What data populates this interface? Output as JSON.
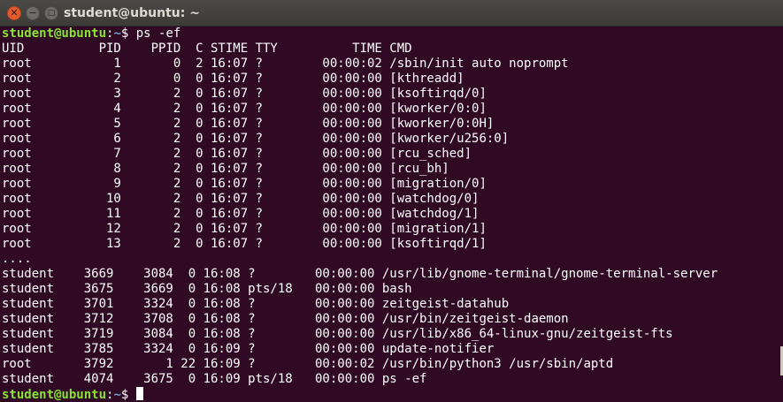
{
  "window": {
    "title": "student@ubuntu: ~",
    "close_glyph": "✕",
    "minimize_glyph": "−",
    "maximize_glyph": "□"
  },
  "terminal": {
    "lines": [
      {
        "kind": "prompt",
        "user": "student@ubuntu",
        "sep": ":",
        "path": "~",
        "symbol": "$ ",
        "cmd": "ps -ef"
      },
      {
        "kind": "text",
        "text": "UID          PID    PPID  C STIME TTY          TIME CMD"
      },
      {
        "kind": "text",
        "text": "root           1       0  2 16:07 ?        00:00:02 /sbin/init auto noprompt"
      },
      {
        "kind": "text",
        "text": "root           2       0  0 16:07 ?        00:00:00 [kthreadd]"
      },
      {
        "kind": "text",
        "text": "root           3       2  0 16:07 ?        00:00:00 [ksoftirqd/0]"
      },
      {
        "kind": "text",
        "text": "root           4       2  0 16:07 ?        00:00:00 [kworker/0:0]"
      },
      {
        "kind": "text",
        "text": "root           5       2  0 16:07 ?        00:00:00 [kworker/0:0H]"
      },
      {
        "kind": "text",
        "text": "root           6       2  0 16:07 ?        00:00:00 [kworker/u256:0]"
      },
      {
        "kind": "text",
        "text": "root           7       2  0 16:07 ?        00:00:00 [rcu_sched]"
      },
      {
        "kind": "text",
        "text": "root           8       2  0 16:07 ?        00:00:00 [rcu_bh]"
      },
      {
        "kind": "text",
        "text": "root           9       2  0 16:07 ?        00:00:00 [migration/0]"
      },
      {
        "kind": "text",
        "text": "root          10       2  0 16:07 ?        00:00:00 [watchdog/0]"
      },
      {
        "kind": "text",
        "text": "root          11       2  0 16:07 ?        00:00:00 [watchdog/1]"
      },
      {
        "kind": "text",
        "text": "root          12       2  0 16:07 ?        00:00:00 [migration/1]"
      },
      {
        "kind": "text",
        "text": "root          13       2  0 16:07 ?        00:00:00 [ksoftirqd/1]"
      },
      {
        "kind": "text",
        "text": "...."
      },
      {
        "kind": "text",
        "text": "student    3669    3084  0 16:08 ?        00:00:00 /usr/lib/gnome-terminal/gnome-terminal-server"
      },
      {
        "kind": "text",
        "text": "student    3675    3669  0 16:08 pts/18   00:00:00 bash"
      },
      {
        "kind": "text",
        "text": "student    3701    3324  0 16:08 ?        00:00:00 zeitgeist-datahub"
      },
      {
        "kind": "text",
        "text": "student    3712    3708  0 16:08 ?        00:00:00 /usr/bin/zeitgeist-daemon"
      },
      {
        "kind": "text",
        "text": "student    3719    3084  0 16:08 ?        00:00:00 /usr/lib/x86_64-linux-gnu/zeitgeist-fts"
      },
      {
        "kind": "text",
        "text": "student    3785    3324  0 16:09 ?        00:00:00 update-notifier"
      },
      {
        "kind": "text",
        "text": "root       3792       1 22 16:09 ?        00:00:02 /usr/bin/python3 /usr/sbin/aptd"
      },
      {
        "kind": "text",
        "text": "student    4074    3675  0 16:09 pts/18   00:00:00 ps -ef"
      },
      {
        "kind": "prompt",
        "user": "student@ubuntu",
        "sep": ":",
        "path": "~",
        "symbol": "$ ",
        "cmd": "",
        "cursor": true
      }
    ]
  },
  "colors": {
    "background": "#300a24",
    "prompt_user": "#8ae234",
    "prompt_path": "#729fcf",
    "text": "#ffffff"
  }
}
